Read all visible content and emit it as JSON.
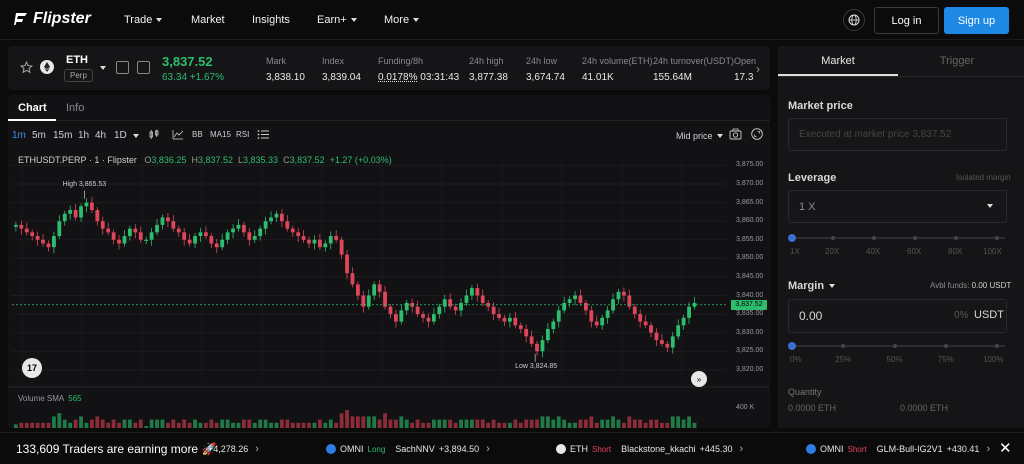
{
  "nav": {
    "brand": "Flipster",
    "items": [
      {
        "label": "Trade",
        "caret": true
      },
      {
        "label": "Market",
        "caret": false
      },
      {
        "label": "Insights",
        "caret": false
      },
      {
        "label": "Earn+",
        "caret": true
      },
      {
        "label": "More",
        "caret": true
      }
    ],
    "login": "Log in",
    "signup": "Sign up",
    "accent": "#1e88e5"
  },
  "ticker": {
    "symbol": "ETH",
    "badge": "Perp",
    "price": "3,837.52",
    "change": "63.34 +1.67%",
    "stats": [
      {
        "label": "Mark",
        "value": "3,838.10"
      },
      {
        "label": "Index",
        "value": "3,839.04"
      },
      {
        "label": "Funding/8h",
        "value": "0.0178%",
        "extra": "03:31:43"
      },
      {
        "label": "24h high",
        "value": "3,877.38"
      },
      {
        "label": "24h low",
        "value": "3,674.74"
      },
      {
        "label": "24h volume(ETH)",
        "value": "41.01K"
      },
      {
        "label": "24h turnover(USDT)",
        "value": "155.64M"
      },
      {
        "label": "Open",
        "value": "17.3"
      }
    ]
  },
  "chart_panel": {
    "tabs": [
      "Chart",
      "Info"
    ],
    "timeframes": [
      "1m",
      "5m",
      "15m",
      "1h",
      "4h",
      "1D"
    ],
    "tools": [
      "BB",
      "MA15",
      "RSI"
    ],
    "mid_price": "Mid price",
    "ohlc": {
      "symbol": "ETHUSDT.PERP · 1 · Flipster",
      "o": "3,836.25",
      "h": "3,837.52",
      "l": "3,835.33",
      "c": "3,837.52",
      "chg": "+1.27 (+0.03%)"
    },
    "high_label": "High 3,865.53",
    "low_label": "Low 3,824.85",
    "current_price": "3,837.52",
    "y_ticks": [
      "3,875.00",
      "3,870.00",
      "3,865.00",
      "3,860.00",
      "3,855.00",
      "3,850.00",
      "3,845.00",
      "3,840.00",
      "3,835.00",
      "3,830.00",
      "3,825.00",
      "3,820.00"
    ],
    "volume_label": "Volume SMA",
    "volume_value": "565",
    "volume_axis": "400 K",
    "tv_logo": "17"
  },
  "chart_data": {
    "type": "candlestick",
    "ylim": [
      3817,
      3877
    ],
    "close_series": [
      3859,
      3858,
      3857,
      3856,
      3855,
      3854,
      3853,
      3856,
      3860,
      3862,
      3863,
      3861,
      3864,
      3865,
      3863,
      3860,
      3858,
      3857,
      3855,
      3854,
      3856,
      3858,
      3857,
      3855,
      3855,
      3857,
      3859,
      3861,
      3860,
      3858,
      3857,
      3855,
      3854,
      3856,
      3857,
      3856,
      3854,
      3853,
      3855,
      3857,
      3858,
      3859,
      3857,
      3855,
      3856,
      3858,
      3860,
      3861,
      3862,
      3860,
      3858,
      3857,
      3856,
      3855,
      3854,
      3855,
      3853,
      3854,
      3856,
      3855,
      3851,
      3846,
      3843,
      3840,
      3837,
      3840,
      3843,
      3841,
      3837,
      3835,
      3833,
      3836,
      3838,
      3837,
      3835,
      3834,
      3833,
      3835,
      3837,
      3839,
      3837,
      3836,
      3838,
      3840,
      3842,
      3840,
      3838,
      3837,
      3835,
      3834,
      3833,
      3834,
      3832,
      3831,
      3829,
      3827,
      3825,
      3828,
      3831,
      3833,
      3836,
      3838,
      3839,
      3840,
      3838,
      3836,
      3833,
      3832,
      3834,
      3836,
      3839,
      3841,
      3840,
      3837,
      3835,
      3833,
      3832,
      3830,
      3828,
      3827,
      3826,
      3829,
      3832,
      3834,
      3837,
      3838
    ],
    "high_annotation": 3865.53,
    "low_annotation": 3824.85,
    "last": 3837.52
  },
  "order_panel": {
    "tabs": [
      "Market",
      "Trigger"
    ],
    "market_price_title": "Market price",
    "market_price_placeholder": "Executed at market price 3,837.52",
    "leverage_title": "Leverage",
    "leverage_hint": "Isolated margin",
    "leverage_value": "1 X",
    "leverage_ticks": [
      "1X",
      "20X",
      "40X",
      "60X",
      "80X",
      "100X"
    ],
    "margin_title": "Margin",
    "avbl_label": "Avbl funds:",
    "avbl_value": "0.00 USDT",
    "margin_value": "0.00",
    "margin_pct": "0%",
    "margin_currency": "USDT",
    "margin_ticks": [
      "0%",
      "25%",
      "50%",
      "75%",
      "100%"
    ],
    "quantity_title": "Quantity",
    "qty1": "0.0000 ETH",
    "qty2": "0.0000 ETH"
  },
  "bottom": {
    "traders": "133,609 Traders are earning more 🚀",
    "items": [
      {
        "text": "+4,278.26",
        "coin": "",
        "side": "",
        "name": ""
      },
      {
        "coin": "OMNI",
        "side": "Long",
        "name": "SachNNV",
        "text": "+3,894.50"
      },
      {
        "coin": "ETH",
        "side": "Short",
        "name": "Blackstone_kkachi",
        "text": "+445.30"
      },
      {
        "coin": "OMNI",
        "side": "Short",
        "name": "GLM-Bull-IG2V1",
        "text": "+430.41"
      }
    ]
  }
}
